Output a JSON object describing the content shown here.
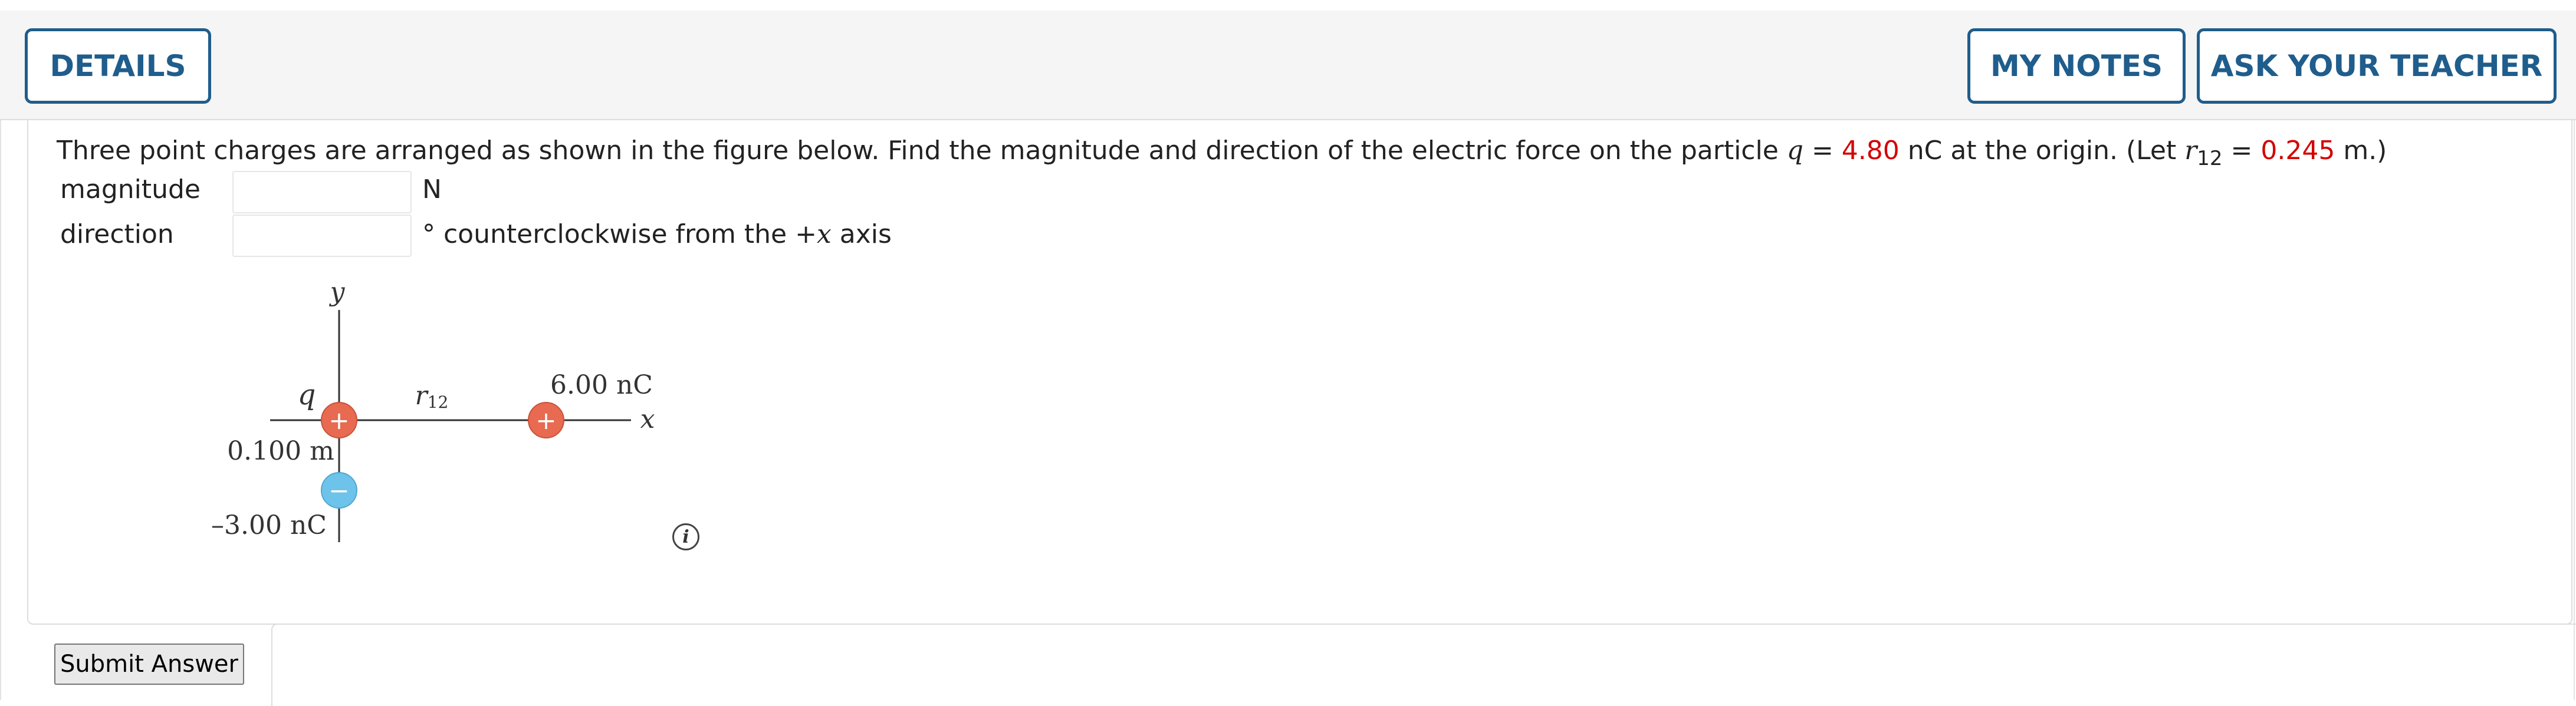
{
  "header": {
    "details_label": "DETAILS",
    "my_notes_label": "MY NOTES",
    "ask_teacher_label": "ASK YOUR TEACHER"
  },
  "question": {
    "text_1": "Three point charges are arranged as shown in the figure below. Find the magnitude and direction of the electric force on the particle ",
    "q_symbol": "q",
    "eq_1": " = ",
    "q_value": "4.80",
    "text_2": " nC at the origin. (Let ",
    "r_symbol": "r",
    "r_subscript": "12",
    "eq_2": " = ",
    "r_value": "0.245",
    "text_3": " m.)"
  },
  "answers": {
    "magnitude_label": "magnitude",
    "magnitude_value": "",
    "magnitude_unit": "N",
    "direction_label": "direction",
    "direction_value": "",
    "direction_unit_prefix": "° counterclockwise from the +",
    "direction_unit_axis": "x",
    "direction_unit_suffix": " axis"
  },
  "figure": {
    "y_axis_label": "y",
    "x_axis_label": "x",
    "q_label": "q",
    "r12_label": "r",
    "r12_sub": "12",
    "charge_right_label": "6.00 nC",
    "distance_label": "0.100 m",
    "charge_bottom_label": "–3.00 nC",
    "positive_sign": "+",
    "negative_sign": "−",
    "positive_color": "#e86a50",
    "negative_color": "#6ec3ea"
  },
  "info_icon_glyph": "i",
  "submit_label": "Submit Answer"
}
